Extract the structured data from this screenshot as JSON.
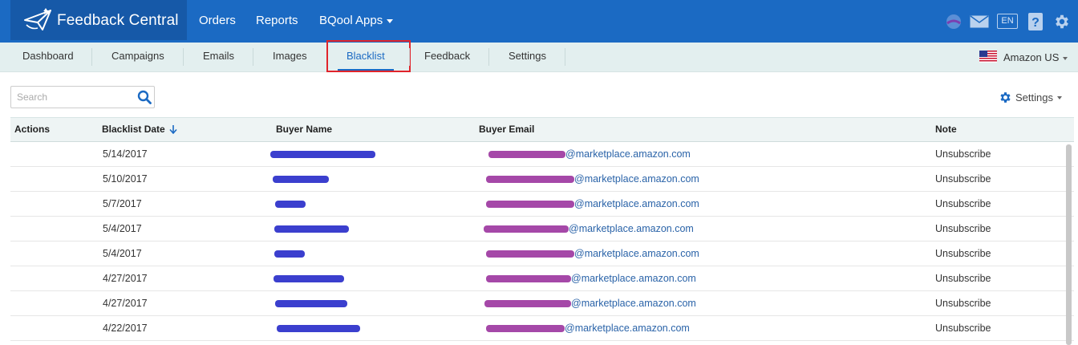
{
  "header": {
    "brand": "Feedback Central",
    "nav": [
      {
        "label": "Orders"
      },
      {
        "label": "Reports"
      },
      {
        "label": "BQool Apps"
      }
    ],
    "language": "EN",
    "icons": [
      "notifications-icon",
      "mail-icon",
      "language-icon",
      "help-icon",
      "gear-icon"
    ]
  },
  "subnav": {
    "tabs": [
      {
        "label": "Dashboard"
      },
      {
        "label": "Campaigns"
      },
      {
        "label": "Emails"
      },
      {
        "label": "Images"
      },
      {
        "label": "Blacklist",
        "active": true
      },
      {
        "label": "Feedback"
      },
      {
        "label": "Settings"
      }
    ],
    "marketplace": "Amazon US"
  },
  "toolbar": {
    "search_placeholder": "Search",
    "settings_label": "Settings"
  },
  "table": {
    "columns": [
      "Actions",
      "Blacklist Date",
      "Buyer Name",
      "Buyer Email",
      "Note"
    ],
    "sort_column": "Blacklist Date",
    "rows": [
      {
        "date": "5/14/2017",
        "email_domain": "@marketplace.amazon.com",
        "note": "Unsubscribe"
      },
      {
        "date": "5/10/2017",
        "email_domain": "@marketplace.amazon.com",
        "note": "Unsubscribe"
      },
      {
        "date": "5/7/2017",
        "email_domain": "@marketplace.amazon.com",
        "note": "Unsubscribe"
      },
      {
        "date": "5/4/2017",
        "email_domain": "@marketplace.amazon.com",
        "note": "Unsubscribe"
      },
      {
        "date": "5/4/2017",
        "email_domain": "@marketplace.amazon.com",
        "note": "Unsubscribe"
      },
      {
        "date": "4/27/2017",
        "email_domain": "@marketplace.amazon.com",
        "note": "Unsubscribe"
      },
      {
        "date": "4/27/2017",
        "email_domain": "@marketplace.amazon.com",
        "note": "Unsubscribe"
      },
      {
        "date": "4/22/2017",
        "email_domain": "@marketplace.amazon.com",
        "note": "Unsubscribe"
      }
    ]
  },
  "colors": {
    "header_bg": "#1b6ac3",
    "brand_bg": "#1659a8",
    "subnav_bg": "#e3efef",
    "highlight": "#e0242b",
    "link": "#2a63a8",
    "redact_name": "#3b3fce",
    "redact_email": "#a548a8"
  }
}
